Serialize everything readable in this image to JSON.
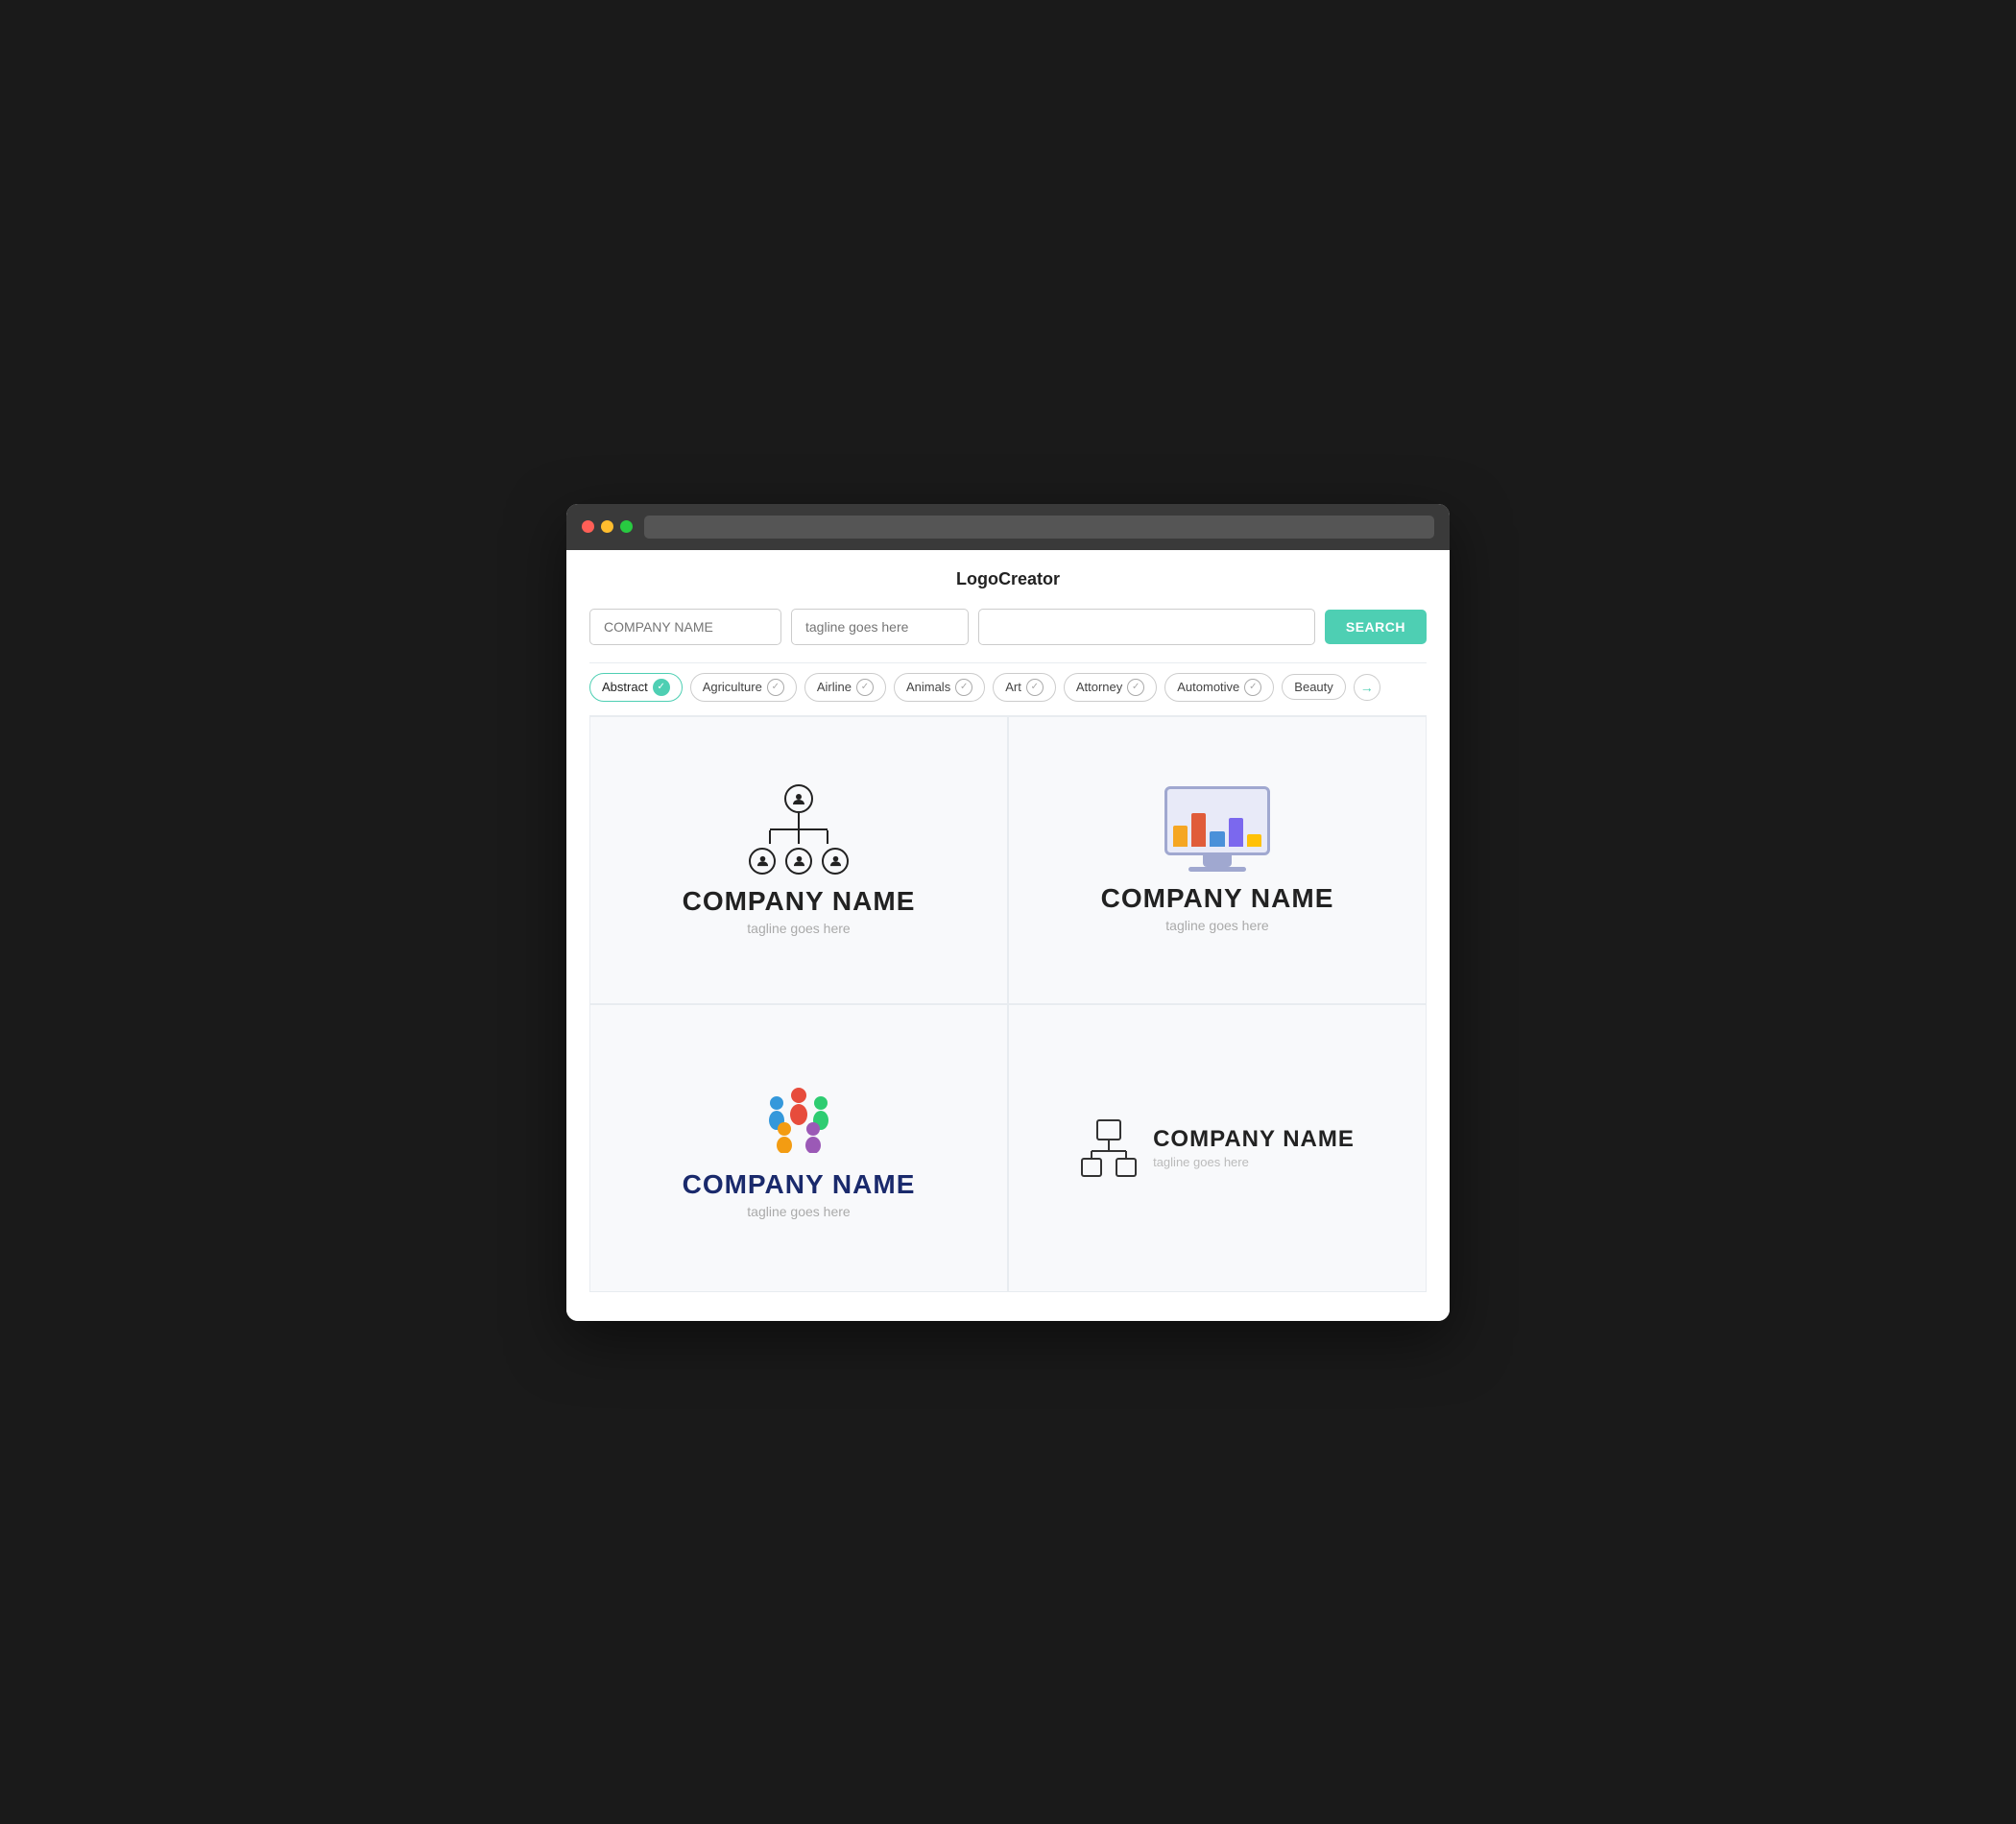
{
  "app": {
    "title": "LogoCreator"
  },
  "search": {
    "company_placeholder": "COMPANY NAME",
    "tagline_placeholder": "tagline goes here",
    "extra_placeholder": "",
    "button_label": "SEARCH"
  },
  "categories": [
    {
      "label": "Abstract",
      "active": true
    },
    {
      "label": "Agriculture",
      "active": false
    },
    {
      "label": "Airline",
      "active": false
    },
    {
      "label": "Animals",
      "active": false
    },
    {
      "label": "Art",
      "active": false
    },
    {
      "label": "Attorney",
      "active": false
    },
    {
      "label": "Automotive",
      "active": false
    },
    {
      "label": "Beauty",
      "active": false
    }
  ],
  "logos": [
    {
      "id": 1,
      "company_name": "COMPANY NAME",
      "tagline": "tagline goes here",
      "color": "#222"
    },
    {
      "id": 2,
      "company_name": "COMPANY NAME",
      "tagline": "tagline goes here",
      "color": "#222"
    },
    {
      "id": 3,
      "company_name": "COMPANY NAME",
      "tagline": "tagline goes here",
      "color": "#1a2a6c"
    },
    {
      "id": 4,
      "company_name": "COMPANY NAME",
      "tagline": "tagline goes here",
      "color": "#222"
    }
  ],
  "bars": [
    {
      "height": 40,
      "color": "#f5a623"
    },
    {
      "height": 55,
      "color": "#e05c3a"
    },
    {
      "height": 32,
      "color": "#4a90d9"
    },
    {
      "height": 48,
      "color": "#7b68ee"
    },
    {
      "height": 25,
      "color": "#e0c040"
    }
  ]
}
